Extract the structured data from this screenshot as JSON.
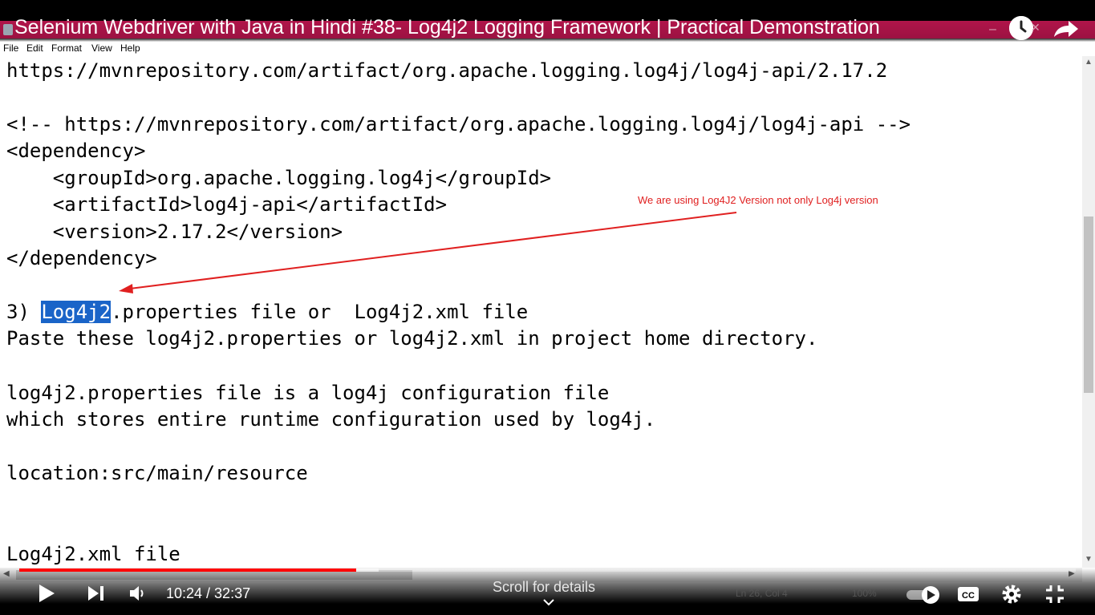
{
  "video": {
    "title": "Selenium Webdriver with Java in Hindi #38- Log4j2 Logging Framework | Practical Demonstration",
    "current_time": "10:24",
    "duration": "32:37",
    "time_display": "10:24 / 32:37",
    "progress_fraction": 0.319,
    "scroll_hint": "Scroll for details"
  },
  "window_controls": {
    "minimize": "–",
    "close": "✕"
  },
  "menu": [
    "File",
    "Edit",
    "Format",
    "View",
    "Help"
  ],
  "editor": {
    "lines": [
      "https://mvnrepository.com/artifact/org.apache.logging.log4j/log4j-api/2.17.2",
      "",
      "<!-- https://mvnrepository.com/artifact/org.apache.logging.log4j/log4j-api -->",
      "<dependency>",
      "    <groupId>org.apache.logging.log4j</groupId>",
      "    <artifactId>log4j-api</artifactId>",
      "    <version>2.17.2</version>",
      "</dependency>",
      "",
      "3) ",
      "Paste these log4j2.properties or log4j2.xml in project home directory.",
      "",
      "log4j2.properties file is a log4j configuration file",
      "which stores entire runtime configuration used by log4j.",
      "",
      "location:src/main/resource",
      "",
      "",
      "Log4j2.xml file"
    ],
    "line9_selected": "Log4j2",
    "line9_rest": ".properties file or  Log4j2.xml file",
    "annotation": "We are using Log4J2 Version not only Log4j version"
  },
  "statusbar_ghost": {
    "position": "Ln 26, Col 4",
    "zoom": "100%",
    "line_ending": "Windows (CRLF)"
  },
  "icons": {
    "watch_later": "clock-icon",
    "share": "share-arrow-icon",
    "play": "play-icon",
    "next": "next-icon",
    "volume": "volume-icon",
    "autoplay": "autoplay-toggle-icon",
    "captions": "cc-icon",
    "settings": "gear-icon",
    "exit_fullscreen": "exit-fullscreen-icon",
    "chevron": "chevron-down-icon"
  },
  "colors": {
    "title_bar": "#b0154a",
    "selection": "#1a64c8",
    "annotation": "#e02020",
    "progress": "#ff0000"
  }
}
